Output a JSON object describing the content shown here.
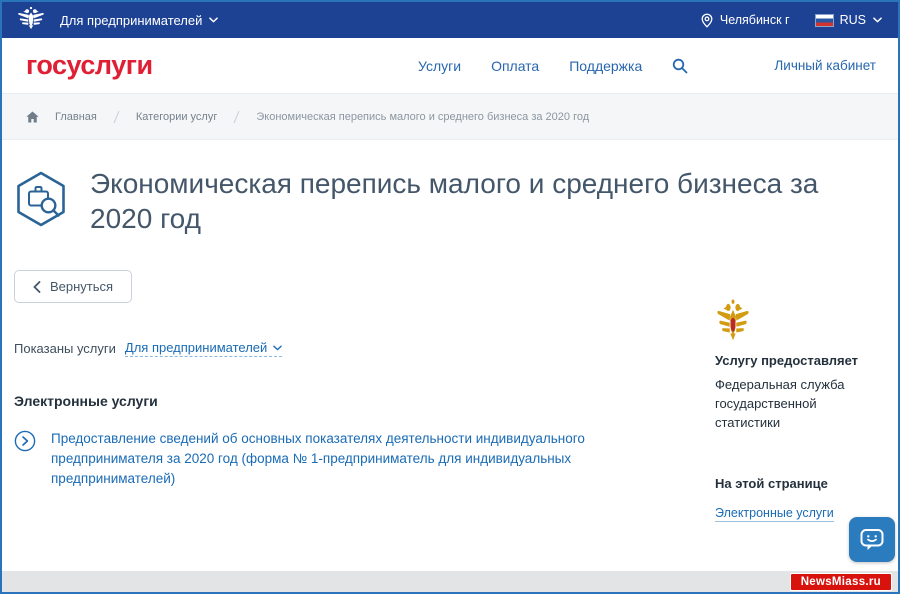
{
  "topbar": {
    "audience": {
      "label": "Для предпринимателей"
    },
    "location": {
      "label": "Челябинск г"
    },
    "language": {
      "label": "RUS"
    }
  },
  "header": {
    "logo": {
      "text": "госуслуги"
    },
    "nav": {
      "items": [
        {
          "label": "Услуги"
        },
        {
          "label": "Оплата"
        },
        {
          "label": "Поддержка"
        }
      ]
    },
    "account": {
      "label": "Личный кабинет"
    }
  },
  "breadcrumbs": {
    "items": [
      {
        "label": "Главная"
      },
      {
        "label": "Категории услуг"
      },
      {
        "label": "Экономическая перепись малого и среднего бизнеса за 2020 год"
      }
    ]
  },
  "content": {
    "title": "Экономическая перепись малого и среднего бизнеса за 2020 год",
    "back": {
      "label": "Вернуться"
    },
    "filter": {
      "label": "Показаны услуги",
      "value": "Для предпринимателей"
    },
    "services": {
      "heading": "Электронные услуги",
      "items": [
        {
          "label": "Предоставление сведений об основных показателях деятельности индивидуального предпринимателя за 2020 год (форма № 1-предприниматель для индивидуальных предпринимателей)"
        }
      ]
    }
  },
  "sidebar": {
    "provider": {
      "heading": "Услугу предоставляет",
      "name": "Федеральная служба государственной статистики"
    },
    "onpage": {
      "heading": "На этой странице",
      "links": [
        {
          "label": "Электронные услуги"
        }
      ]
    }
  },
  "watermark": {
    "label": "NewsMiass.ru"
  },
  "icons": {
    "coat_of_arms": "double-headed-eagle",
    "location": "map-pin",
    "language_flag": "russian-flag",
    "search": "magnifier",
    "home": "house",
    "category": "hexagon-briefcase-magnifier",
    "service": "circle-chevron-right",
    "chat": "speech-bubble-smiley"
  },
  "colors": {
    "topbar_bg": "#1d4294",
    "logo_red": "#df1f34",
    "nav_link": "#2767ae",
    "body_link": "#1a6bb5",
    "title_text": "#44576a",
    "icon_accent": "#2a6496",
    "chat_bg": "#2b7bbf",
    "watermark_bg": "#d8130e"
  }
}
